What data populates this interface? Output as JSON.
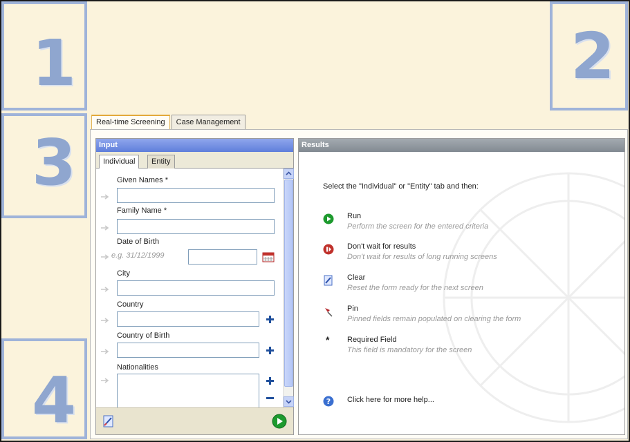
{
  "zones": [
    "1",
    "2",
    "3",
    "4"
  ],
  "tabs": [
    "Real-time Screening",
    "Case Management"
  ],
  "input": {
    "title": "Input",
    "subtabs": [
      "Individual",
      "Entity"
    ],
    "fields": {
      "given_names": "Given Names *",
      "family_name": "Family Name *",
      "dob": "Date of Birth",
      "dob_hint": "e.g. 31/12/1999",
      "city": "City",
      "country": "Country",
      "country_of_birth": "Country of Birth",
      "nationalities": "Nationalities"
    }
  },
  "results": {
    "title": "Results",
    "intro": "Select the \"Individual\" or \"Entity\" tab and then:",
    "items": [
      {
        "icon": "run-icon",
        "title": "Run",
        "desc": "Perform the screen for the entered criteria"
      },
      {
        "icon": "dont-wait-icon",
        "title": "Don't wait for results",
        "desc": "Don't wait for results of long running screens"
      },
      {
        "icon": "clear-icon",
        "title": "Clear",
        "desc": "Reset the form ready for the next screen"
      },
      {
        "icon": "pin-icon",
        "title": "Pin",
        "desc": "Pinned fields remain populated on clearing the form"
      },
      {
        "icon": "asterisk-icon",
        "title": "Required Field",
        "desc": "This field is mandatory for the screen",
        "symbol": "*"
      }
    ],
    "help": "Click here for more help..."
  },
  "colors": {
    "background": "#fbf3dc",
    "zone_border": "#9fb3d9",
    "input_header": "#6f8be0",
    "results_header": "#8f979e",
    "run_green": "#1d9a2e",
    "stop_red": "#c0312b",
    "plus_blue": "#1f4f9c"
  }
}
